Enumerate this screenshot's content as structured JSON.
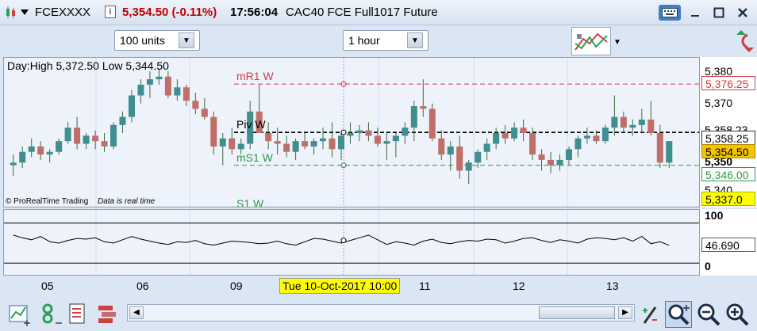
{
  "title_bar": {
    "symbol": "FCEXXXX",
    "price_change": "5,354.50 (-0.11%)",
    "time": "17:56:04",
    "description": "CAC40 FCE Full1017 Future",
    "colors": {
      "price_change": "#c00000"
    }
  },
  "toolbar": {
    "units_select": "100 units",
    "timeframe_select": "1 hour"
  },
  "price_pane": {
    "info": "Day:High 5,372.50 Low 5,344.50",
    "credit": "© ProRealTime Trading",
    "realtime_note": "Data is real time",
    "levels": {
      "mr1": "mR1 W",
      "pivot": "Piv W",
      "ms1": "mS1 W",
      "s1": "S1 W"
    }
  },
  "price_axis": {
    "ticks": [
      "5,380",
      "5,370",
      "5,358.23",
      "5,350",
      "5,340"
    ],
    "badges": {
      "mr1": "5,376.25",
      "pivot": "5,358.25",
      "last": "5,354.50",
      "ms1": "5,346.00",
      "s1": "5,337.0"
    },
    "colors": {
      "mr1": "#d04040",
      "ms1": "#2e9a44",
      "last_bg": "#f5c400",
      "s1_bg": "#ffff00"
    }
  },
  "osc_axis": {
    "top": "100",
    "value": "46.690",
    "bottom": "0"
  },
  "time_axis": {
    "labels": [
      "05",
      "06",
      "09",
      "11",
      "12",
      "13"
    ],
    "cursor_label": "Tue 10-Oct-2017 10:00"
  },
  "chart_data": {
    "type": "candlestick",
    "ylim": [
      5330,
      5386
    ],
    "candles": [
      [
        5346,
        5350,
        5342,
        5347
      ],
      [
        5347,
        5353,
        5345,
        5351
      ],
      [
        5351,
        5356,
        5349,
        5353
      ],
      [
        5353,
        5355,
        5348,
        5350
      ],
      [
        5350,
        5352,
        5347,
        5351
      ],
      [
        5351,
        5356,
        5350,
        5355
      ],
      [
        5355,
        5362,
        5354,
        5360
      ],
      [
        5360,
        5364,
        5352,
        5354
      ],
      [
        5354,
        5358,
        5352,
        5357
      ],
      [
        5357,
        5359,
        5352,
        5355
      ],
      [
        5355,
        5358,
        5351,
        5353
      ],
      [
        5353,
        5362,
        5352,
        5361
      ],
      [
        5361,
        5366,
        5358,
        5364
      ],
      [
        5364,
        5374,
        5362,
        5372
      ],
      [
        5372,
        5378,
        5369,
        5376
      ],
      [
        5376,
        5381,
        5371,
        5378
      ],
      [
        5378,
        5382,
        5376,
        5379
      ],
      [
        5379,
        5381,
        5371,
        5372
      ],
      [
        5372,
        5378,
        5370,
        5375
      ],
      [
        5375,
        5376,
        5368,
        5370
      ],
      [
        5370,
        5373,
        5365,
        5367
      ],
      [
        5367,
        5371,
        5363,
        5364
      ],
      [
        5364,
        5366,
        5350,
        5353
      ],
      [
        5353,
        5358,
        5346,
        5356
      ],
      [
        5356,
        5360,
        5350,
        5352
      ],
      [
        5352,
        5356,
        5350,
        5354
      ],
      [
        5354,
        5370,
        5352,
        5366
      ],
      [
        5366,
        5376,
        5360,
        5358
      ],
      [
        5358,
        5362,
        5352,
        5355
      ],
      [
        5355,
        5360,
        5350,
        5354
      ],
      [
        5354,
        5357,
        5349,
        5351
      ],
      [
        5351,
        5356,
        5348,
        5355
      ],
      [
        5355,
        5358,
        5352,
        5353
      ],
      [
        5353,
        5356,
        5350,
        5355
      ],
      [
        5355,
        5360,
        5352,
        5356
      ],
      [
        5356,
        5362,
        5349,
        5352
      ],
      [
        5352,
        5358,
        5348,
        5357
      ],
      [
        5357,
        5362,
        5354,
        5358
      ],
      [
        5358,
        5361,
        5355,
        5359
      ],
      [
        5359,
        5362,
        5355,
        5357
      ],
      [
        5357,
        5360,
        5353,
        5354
      ],
      [
        5354,
        5358,
        5348,
        5355
      ],
      [
        5355,
        5358,
        5349,
        5357
      ],
      [
        5357,
        5362,
        5354,
        5360
      ],
      [
        5360,
        5370,
        5355,
        5368
      ],
      [
        5368,
        5378,
        5364,
        5367
      ],
      [
        5367,
        5369,
        5355,
        5356
      ],
      [
        5356,
        5359,
        5348,
        5350
      ],
      [
        5350,
        5355,
        5344,
        5353
      ],
      [
        5353,
        5357,
        5341,
        5344
      ],
      [
        5344,
        5348,
        5339,
        5347
      ],
      [
        5347,
        5352,
        5345,
        5351
      ],
      [
        5351,
        5356,
        5348,
        5354
      ],
      [
        5354,
        5360,
        5352,
        5358
      ],
      [
        5358,
        5361,
        5354,
        5356
      ],
      [
        5356,
        5362,
        5355,
        5360
      ],
      [
        5360,
        5363,
        5355,
        5358
      ],
      [
        5358,
        5360,
        5348,
        5350
      ],
      [
        5350,
        5352,
        5344,
        5348
      ],
      [
        5348,
        5351,
        5343,
        5346
      ],
      [
        5346,
        5350,
        5344,
        5348
      ],
      [
        5348,
        5353,
        5346,
        5352
      ],
      [
        5352,
        5357,
        5349,
        5356
      ],
      [
        5356,
        5360,
        5354,
        5357
      ],
      [
        5357,
        5359,
        5354,
        5355
      ],
      [
        5355,
        5361,
        5354,
        5360
      ],
      [
        5360,
        5372,
        5357,
        5364
      ],
      [
        5364,
        5366,
        5358,
        5360
      ],
      [
        5360,
        5363,
        5357,
        5361
      ],
      [
        5361,
        5367,
        5358,
        5363
      ],
      [
        5363,
        5370,
        5357,
        5358
      ],
      [
        5358,
        5361,
        5345,
        5347
      ],
      [
        5347,
        5355,
        5345,
        5355
      ]
    ],
    "oscillator": [
      62,
      58,
      55,
      60,
      52,
      50,
      54,
      57,
      56,
      58,
      52,
      50,
      55,
      60,
      56,
      53,
      50,
      48,
      52,
      51,
      54,
      49,
      47,
      50,
      53,
      52,
      51,
      49,
      50,
      53,
      49,
      47,
      52,
      57,
      56,
      53,
      50,
      54,
      58,
      62,
      55,
      48,
      52,
      50,
      47,
      53,
      56,
      51,
      49,
      52,
      54,
      53,
      56,
      55,
      50,
      53,
      57,
      58,
      54,
      51,
      55,
      53,
      50,
      56,
      58,
      57,
      55,
      58,
      53,
      60,
      49,
      52,
      46.69
    ],
    "oscillator_ylim": [
      0,
      100
    ],
    "oscillator_bands": [
      80,
      20
    ]
  }
}
